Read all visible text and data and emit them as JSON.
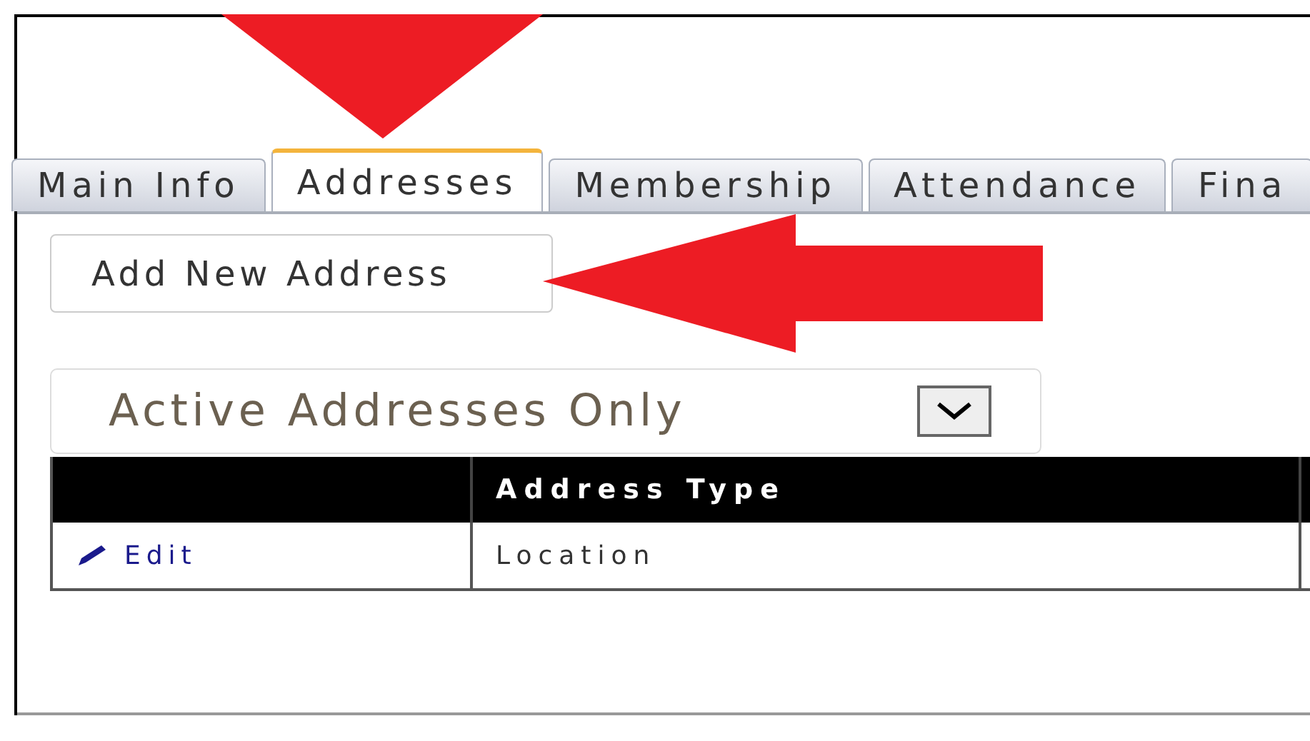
{
  "tabs": [
    {
      "label": "Main Info",
      "selected": false
    },
    {
      "label": "Addresses",
      "selected": true
    },
    {
      "label": "Membership",
      "selected": false
    },
    {
      "label": "Attendance",
      "selected": false
    },
    {
      "label": "Fina",
      "selected": false
    }
  ],
  "add_button": "Add New Address",
  "filter": {
    "value": "Active Addresses Only"
  },
  "table": {
    "columns": [
      "Address Type"
    ],
    "rows": [
      {
        "action": "Edit",
        "address_type": "Location"
      }
    ]
  }
}
